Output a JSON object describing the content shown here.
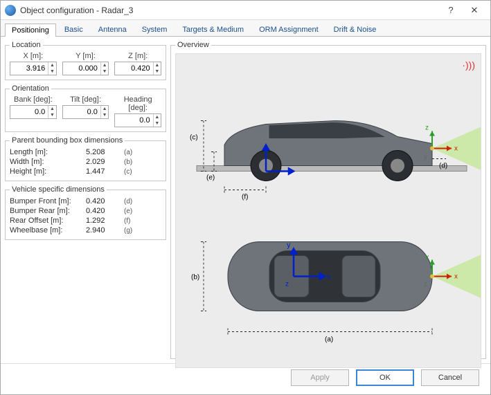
{
  "title": "Object configuration - Radar_3",
  "tabs": [
    {
      "label": "Positioning",
      "active": true
    },
    {
      "label": "Basic"
    },
    {
      "label": "Antenna"
    },
    {
      "label": "System"
    },
    {
      "label": "Targets & Medium"
    },
    {
      "label": "ORM Assignment"
    },
    {
      "label": "Drift & Noise"
    }
  ],
  "location": {
    "title": "Location",
    "x_label": "X [m]:",
    "y_label": "Y [m]:",
    "z_label": "Z [m]:",
    "x": "3.916",
    "y": "0.000",
    "z": "0.420"
  },
  "orientation": {
    "title": "Orientation",
    "bank_label": "Bank [deg]:",
    "tilt_label": "Tilt [deg]:",
    "heading_label": "Heading [deg]:",
    "bank": "0.0",
    "tilt": "0.0",
    "heading": "0.0"
  },
  "parent_box": {
    "title": "Parent bounding box dimensions",
    "rows": [
      {
        "label": "Length [m]:",
        "value": "5.208",
        "tag": "(a)"
      },
      {
        "label": "Width [m]:",
        "value": "2.029",
        "tag": "(b)"
      },
      {
        "label": "Height [m]:",
        "value": "1.447",
        "tag": "(c)"
      }
    ]
  },
  "vehicle_dims": {
    "title": "Vehicle specific dimensions",
    "rows": [
      {
        "label": "Bumper Front [m]:",
        "value": "0.420",
        "tag": "(d)"
      },
      {
        "label": "Bumper Rear [m]:",
        "value": "0.420",
        "tag": "(e)"
      },
      {
        "label": "Rear Offset [m]:",
        "value": "1.292",
        "tag": "(f)"
      },
      {
        "label": "Wheelbase [m]:",
        "value": "2.940",
        "tag": "(g)"
      }
    ]
  },
  "overview_title": "Overview",
  "buttons": {
    "apply": "Apply",
    "ok": "OK",
    "cancel": "Cancel"
  },
  "diagram_labels": {
    "a": "(a)",
    "b": "(b)",
    "c": "(c)",
    "d": "(d)",
    "e": "(e)",
    "f": "(f)",
    "x": "x",
    "y": "y",
    "z": "z"
  }
}
